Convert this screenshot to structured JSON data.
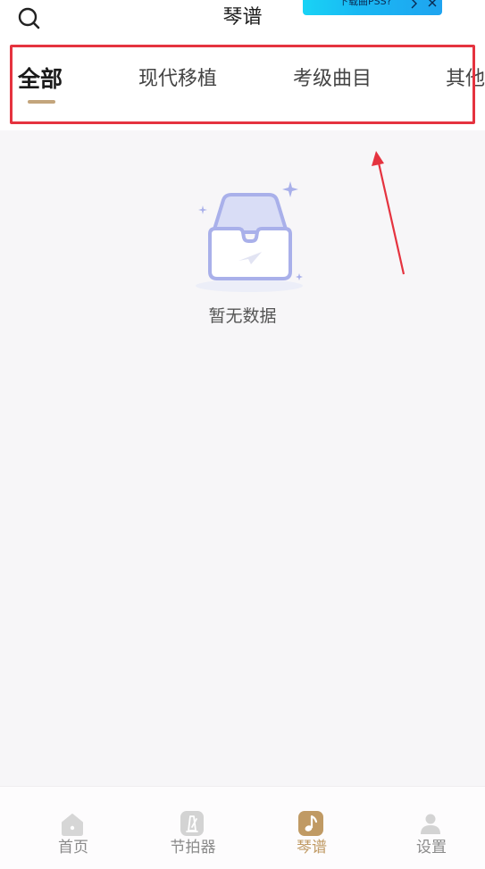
{
  "header": {
    "title": "琴谱",
    "search_icon": "search-icon",
    "promo": {
      "text": "下载曲PSS?",
      "arrow_icon": "chevron-right-icon",
      "close_icon": "close-icon",
      "color": "#19c4f4"
    }
  },
  "tabs": [
    {
      "label": "全部",
      "active": true
    },
    {
      "label": "现代移植",
      "active": false
    },
    {
      "label": "考级曲目",
      "active": false
    },
    {
      "label": "其他",
      "active": false
    }
  ],
  "annotation": {
    "box_color": "#e5333f"
  },
  "empty_state": {
    "icon": "empty-inbox-icon",
    "text": "暂无数据"
  },
  "bottom_nav": [
    {
      "label": "首页",
      "icon": "home-icon",
      "active": false
    },
    {
      "label": "节拍器",
      "icon": "metronome-icon",
      "active": false
    },
    {
      "label": "琴谱",
      "icon": "music-note-icon",
      "active": true
    },
    {
      "label": "设置",
      "icon": "person-icon",
      "active": false
    }
  ],
  "colors": {
    "accent": "#c09a64",
    "tab_indicator": "#c3a57c",
    "background": "#f7f6f8",
    "empty_icon": "#a9b0ea"
  }
}
